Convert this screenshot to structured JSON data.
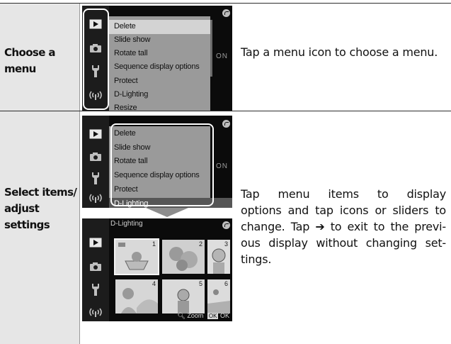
{
  "rows": [
    {
      "label": "Choose a menu",
      "label_lines": [
        "Choose a",
        "menu"
      ],
      "description": "Tap a menu icon to choose a menu."
    },
    {
      "label": "Select items/ adjust settings",
      "label_lines": [
        "Select items/",
        "adjust",
        "settings"
      ],
      "description": "Tap menu items to display options and tap icons or sliders to change. Tap ⒮ to exit to the previous display without changing settings.",
      "description_lines": [
        "Tap menu items to display",
        "options and tap icons or sliders to",
        "change. Tap ➔ to exit to the previ-",
        "ous display without changing set-",
        "tings."
      ]
    }
  ],
  "menu": {
    "items": [
      "Delete",
      "Slide show",
      "Rotate tall",
      "Sequence display options",
      "Protect",
      "D-Lighting",
      "Resize"
    ],
    "highlighted_row1": "Delete",
    "highlighted_row2": "D-Lighting",
    "side_value": "ON"
  },
  "tab_icons": [
    "playback-icon",
    "camera-icon",
    "wrench-icon",
    "wireless-icon"
  ],
  "dlighting": {
    "title": "D-Lighting",
    "thumb_numbers": [
      "1",
      "2",
      "3",
      "4",
      "5",
      "6"
    ],
    "zoom_label": "Zoom",
    "ok_label": "OK"
  },
  "colors": {
    "label_bg": "#e6e6e6",
    "menu_bg": "#9a9a9a",
    "highlight_row1": "#d3d3d3",
    "highlight_row2": "#565656",
    "screen_bg": "#0b0b0b"
  }
}
